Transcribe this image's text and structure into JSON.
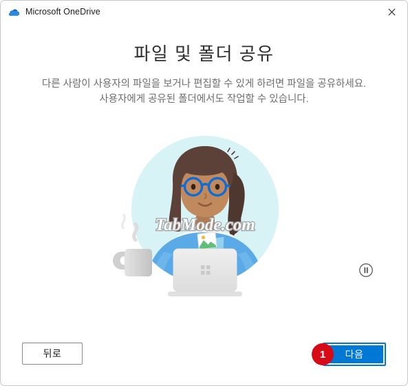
{
  "window": {
    "app_title": "Microsoft OneDrive",
    "cloud_icon": "onedrive-cloud-icon",
    "close_icon": "close-icon"
  },
  "content": {
    "title": "파일 및 폴더 공유",
    "subtitle_line1": "다른 사람이 사용자의 파일을 보거나 편집할 수 있게 하려면 파일을 공유하세요.",
    "subtitle_line2": "사용자에게 공유된 폴더에서도 작업할 수 있습니다."
  },
  "illustration": {
    "name": "woman-sharing-files-illustration",
    "watermark": "TabMode.com",
    "circle_color": "#d8f3f6",
    "shirt_color": "#5aaae8",
    "hair_color": "#5b4138",
    "skin_color": "#c08a5e",
    "glasses_color": "#0f6cd4",
    "laptop_color": "#e4e4e4",
    "mug_color": "#cfcfcf"
  },
  "media_controls": {
    "pause_label": "일시 중지",
    "pause_icon": "pause-icon"
  },
  "footer": {
    "back_label": "뒤로",
    "next_label": "다음",
    "step_badge": "1",
    "accent_color": "#0078d4",
    "badge_color": "#d60b17"
  }
}
